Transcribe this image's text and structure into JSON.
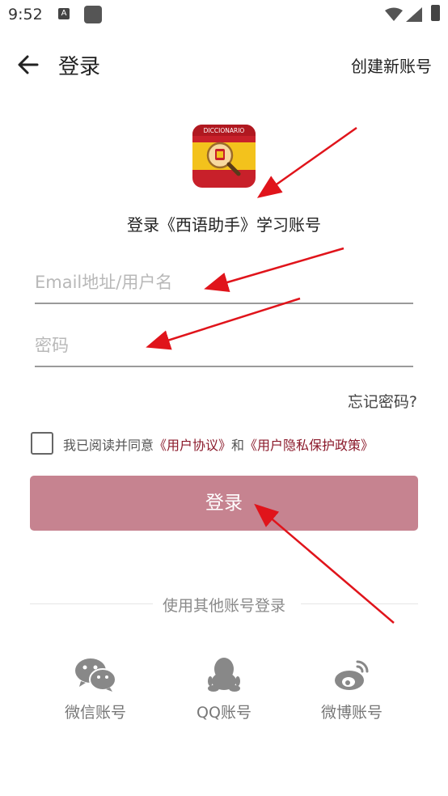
{
  "status_bar": {
    "time": "9:52",
    "a_icon_letter": "A"
  },
  "header": {
    "title": "登录",
    "create_account": "创建新账号"
  },
  "logo": {
    "text": "DICCIONARIO",
    "colors": {
      "red": "#c8202a",
      "yellow": "#f3c21c"
    }
  },
  "subtitle": "登录《西语助手》学习账号",
  "form": {
    "email_placeholder": "Email地址/用户名",
    "password_placeholder": "密码",
    "forgot_password": "忘记密码?"
  },
  "agreement": {
    "prefix": "我已阅读并同意",
    "user_agreement": "《用户协议》",
    "and": "和",
    "privacy_policy": "《用户隐私保护政策》"
  },
  "login_button": "登录",
  "other_login": {
    "divider": "使用其他账号登录",
    "options": [
      {
        "label": "微信账号",
        "icon": "wechat-icon"
      },
      {
        "label": "QQ账号",
        "icon": "qq-icon"
      },
      {
        "label": "微博账号",
        "icon": "weibo-icon"
      }
    ]
  },
  "colors": {
    "accent": "#8b1a2b",
    "button": "#c68390",
    "annotation_arrow": "#e0141b"
  }
}
